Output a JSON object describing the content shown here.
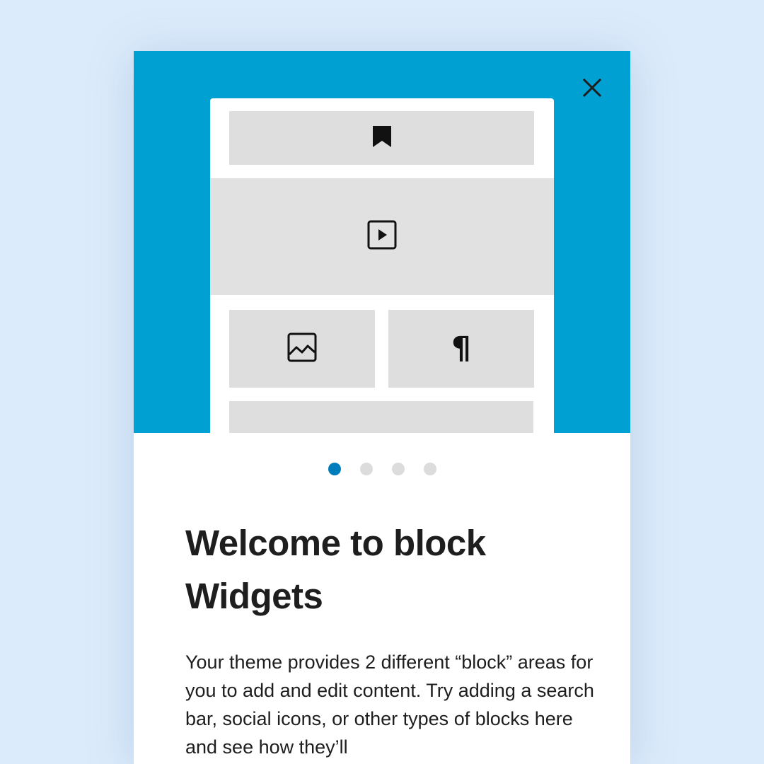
{
  "background_color": "#dcebfb",
  "hero_color": "#00a0d2",
  "accent_color": "#007cba",
  "close_button": {
    "icon": "close-icon"
  },
  "illustration": {
    "blocks": [
      {
        "icon": "bookmark-icon"
      },
      {
        "icon": "video-play-icon"
      },
      {
        "icon": "image-icon"
      },
      {
        "icon": "paragraph-icon",
        "glyph": "¶"
      },
      {
        "icon": "none"
      }
    ]
  },
  "pager": {
    "total": 4,
    "active_index": 0
  },
  "title": "Welcome to block Widgets",
  "body": "Your theme provides 2 different “block” areas for you to add and edit content. Try adding a search bar, social icons, or other types of blocks here and see how they’ll"
}
